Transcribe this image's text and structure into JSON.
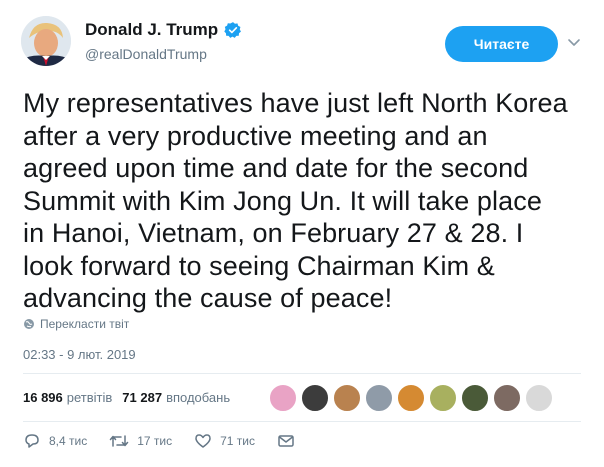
{
  "user": {
    "name": "Donald J. Trump",
    "handle": "@realDonaldTrump"
  },
  "header": {
    "follow_label": "Читаєте"
  },
  "tweet": {
    "text": "My representatives have just left North Korea\nafter a very productive meeting and an\nagreed upon time and date for the second\nSummit with Kim Jong Un. It will take place\nin Hanoi, Vietnam, on February 27 & 28. I\nlook forward to seeing Chairman Kim &\nadvancing the cause of peace!",
    "translate_label": "Перекласти твіт",
    "timestamp": "02:33 - 9 лют. 2019"
  },
  "stats": {
    "retweets_count": "16 896",
    "retweets_label": "ретвітів",
    "likes_count": "71 287",
    "likes_label": "вподобань"
  },
  "likers": {
    "colors": [
      "#e9a3c5",
      "#3c3c3c",
      "#b9824f",
      "#8f9ba8",
      "#d58a32",
      "#a8b05f",
      "#4a5a38",
      "#7d6a62",
      "#d9d9d9"
    ]
  },
  "actions": {
    "replies": "8,4 тис",
    "retweets": "17 тис",
    "likes": "71 тис"
  },
  "colors": {
    "accent": "#1da1f2",
    "muted": "#657786",
    "text": "#14171a"
  }
}
